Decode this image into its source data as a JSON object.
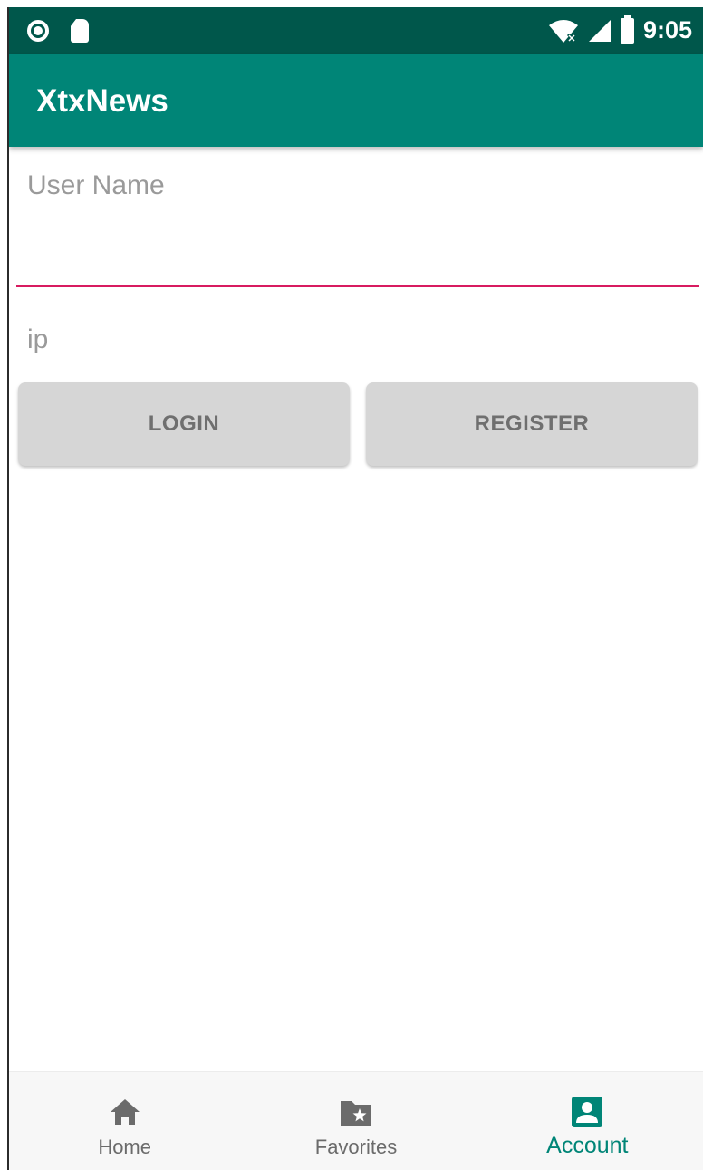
{
  "status_bar": {
    "time": "9:05",
    "icons": [
      "record-icon",
      "sd-card-icon",
      "wifi-off-icon",
      "signal-icon",
      "battery-icon"
    ]
  },
  "app_bar": {
    "title": "XtxNews"
  },
  "form": {
    "username_placeholder": "User Name",
    "ip_label": "ip",
    "login_label": "LOGIN",
    "register_label": "REGISTER"
  },
  "bottom_nav": {
    "items": [
      {
        "label": "Home",
        "icon": "home-icon",
        "active": false
      },
      {
        "label": "Favorites",
        "icon": "favorites-folder-icon",
        "active": false
      },
      {
        "label": "Account",
        "icon": "account-icon",
        "active": true
      }
    ]
  },
  "colors": {
    "status_bar": "#00574b",
    "primary": "#008577",
    "accent": "#d81b60",
    "button_bg": "#d6d6d6",
    "inactive_nav": "#6b6b6b"
  }
}
